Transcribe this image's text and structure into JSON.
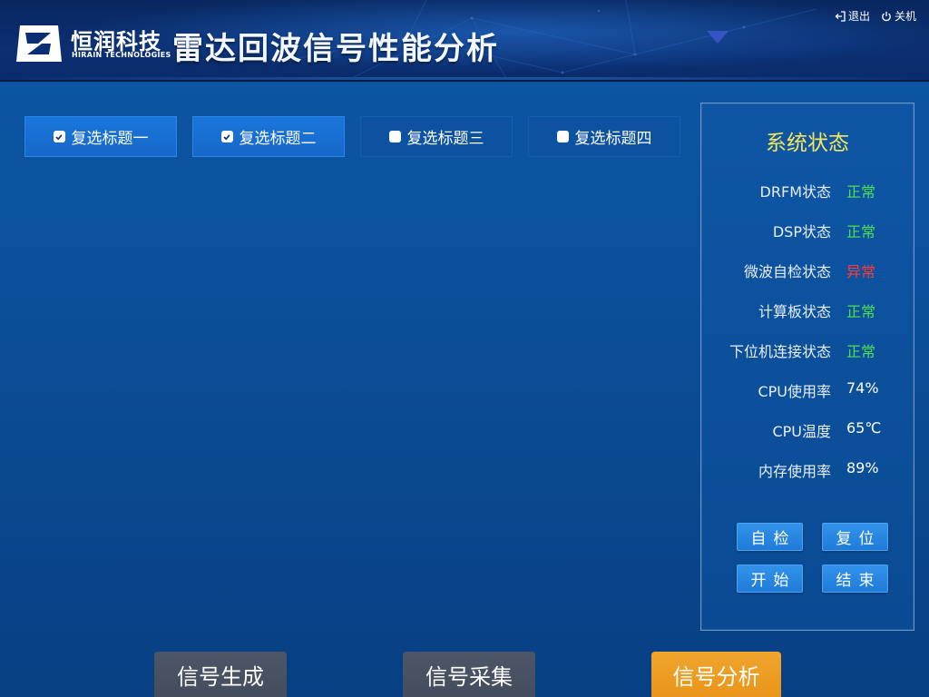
{
  "header": {
    "brand_cn": "恒润科技",
    "brand_en": "HIRAIN TECHNOLOGIES",
    "title": "雷达回波信号性能分析",
    "logout_label": "退出",
    "shutdown_label": "关机"
  },
  "checkbox_tabs": [
    {
      "label": "复选标题一",
      "checked": true
    },
    {
      "label": "复选标题二",
      "checked": true
    },
    {
      "label": "复选标题三",
      "checked": false
    },
    {
      "label": "复选标题四",
      "checked": false
    }
  ],
  "status_panel": {
    "title": "系统状态",
    "rows": [
      {
        "label": "DRFM状态",
        "value": "正常",
        "status": "ok"
      },
      {
        "label": "DSP状态",
        "value": "正常",
        "status": "ok"
      },
      {
        "label": "微波自检状态",
        "value": "异常",
        "status": "error"
      },
      {
        "label": "计算板状态",
        "value": "正常",
        "status": "ok"
      },
      {
        "label": "下位机连接状态",
        "value": "正常",
        "status": "ok"
      },
      {
        "label": "CPU使用率",
        "value": "74%",
        "status": "plain"
      },
      {
        "label": "CPU温度",
        "value": "65℃",
        "status": "plain"
      },
      {
        "label": "内存使用率",
        "value": "89%",
        "status": "plain"
      }
    ],
    "buttons": {
      "self_check": "自检",
      "reset": "复位",
      "start": "开始",
      "end": "结束"
    }
  },
  "bottom_nav": [
    {
      "label": "信号生成",
      "active": false
    },
    {
      "label": "信号采集",
      "active": false
    },
    {
      "label": "信号分析",
      "active": true
    }
  ],
  "colors": {
    "background": "#0b4f99",
    "panel_title": "#f6e65a",
    "status_ok": "#4ce052",
    "status_error": "#ff3b3b",
    "nav_inactive": "#4c5668",
    "nav_active": "#f0a52d",
    "tab_active": "#1b77dd"
  },
  "icons": {
    "logo": "hirain-logo-icon",
    "logout": "logout-icon",
    "shutdown": "power-icon",
    "checkbox_checked": "checkbox-checked-icon",
    "checkbox_unchecked": "checkbox-unchecked-icon"
  }
}
